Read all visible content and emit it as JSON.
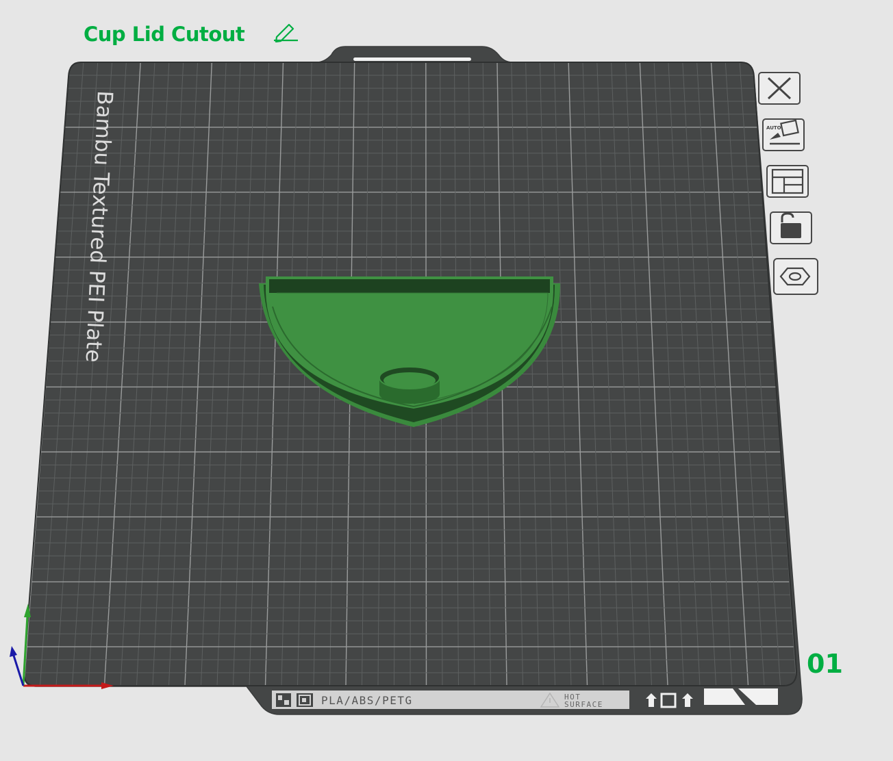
{
  "plate": {
    "name": "Cup Lid Cutout",
    "number": "01",
    "bed_label": "Bambu Textured PEI Plate",
    "materials": "PLA/ABS/PETG",
    "warning_line1": "HOT",
    "warning_line2": "SURFACE"
  },
  "toolbar": {
    "tools": [
      "close-icon",
      "auto-orient-icon",
      "arrange-icon",
      "lock-icon",
      "plate-settings-icon"
    ]
  },
  "colors": {
    "accent": "#00ae42",
    "bed": "#444646",
    "model": "#3f9142",
    "background": "#e6e6e6",
    "axis_x": "#c41a1a",
    "axis_y": "#2fa32f",
    "axis_z": "#1a1aa8"
  }
}
